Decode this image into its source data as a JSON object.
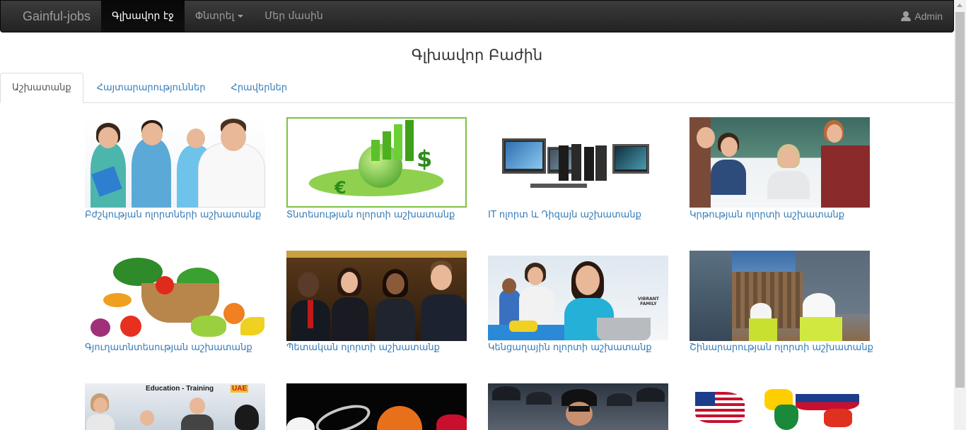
{
  "navbar": {
    "brand": "Gainful-jobs",
    "items": [
      {
        "label": "Գլխավոր էջ",
        "active": true
      },
      {
        "label": "Փնտրել",
        "dropdown": true
      },
      {
        "label": "Մեր մասին"
      }
    ],
    "user": {
      "icon": "user-icon",
      "label": "Admin"
    }
  },
  "page": {
    "title": "Գլխավոր Բաժին"
  },
  "tabs": [
    {
      "label": "Աշխատանք",
      "active": true
    },
    {
      "label": "Հայտարարություններ"
    },
    {
      "label": "Հրավերներ"
    }
  ],
  "categories": [
    {
      "label": "Բժշկության ոլորտների աշխատանք"
    },
    {
      "label": "Տնտեսության ոլորտի աշխատանք"
    },
    {
      "label": "IT ոլորտ և Դիզայն աշխատանք"
    },
    {
      "label": "Կրթության ոլորտի աշխատանք"
    },
    {
      "label": "Գյուղատնտեսության աշխատանք"
    },
    {
      "label": "Պետական ոլորտի աշխատանք"
    },
    {
      "label": "Կենցաղային ոլորտի աշխատանք"
    },
    {
      "label": "Շինարարության ոլորտի աշխատանք"
    },
    {
      "label": ""
    },
    {
      "label": ""
    },
    {
      "label": ""
    },
    {
      "label": ""
    }
  ],
  "image_text": {
    "training_banner": "Education - Training",
    "training_uae": "UAE",
    "service_logo_1": "VIBRANT",
    "service_logo_2": "FAMILY"
  },
  "colors": {
    "link": "#337ab7",
    "navbar": "#222222",
    "economy_border": "#7cc242"
  }
}
